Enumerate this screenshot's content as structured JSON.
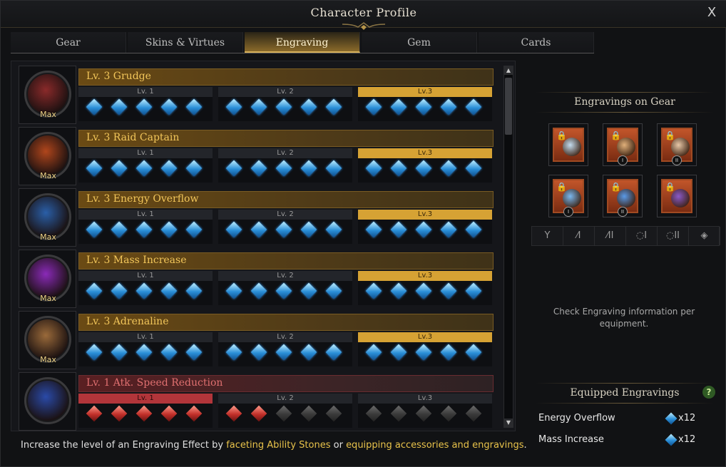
{
  "window": {
    "title": "Character Profile",
    "close_label": "X"
  },
  "tabs": [
    {
      "label": "Gear",
      "active": false
    },
    {
      "label": "Skins & Virtues",
      "active": false
    },
    {
      "label": "Engraving",
      "active": true
    },
    {
      "label": "Gem",
      "active": false
    },
    {
      "label": "Cards",
      "active": false
    }
  ],
  "engravings": [
    {
      "name": "Lv. 3 Grudge",
      "max_label": "Max",
      "levels": [
        "Lv. 1",
        "Lv. 2",
        "Lv.3"
      ],
      "active_level": 3,
      "filled_nodes": 15,
      "type": "positive",
      "color": "#8a2a2a"
    },
    {
      "name": "Lv. 3 Raid Captain",
      "max_label": "Max",
      "levels": [
        "Lv. 1",
        "Lv. 2",
        "Lv.3"
      ],
      "active_level": 3,
      "filled_nodes": 15,
      "type": "positive",
      "color": "#b0461c"
    },
    {
      "name": "Lv. 3 Energy Overflow",
      "max_label": "Max",
      "levels": [
        "Lv. 1",
        "Lv. 2",
        "Lv.3"
      ],
      "active_level": 3,
      "filled_nodes": 15,
      "type": "positive",
      "color": "#2a5fa8"
    },
    {
      "name": "Lv. 3 Mass Increase",
      "max_label": "Max",
      "levels": [
        "Lv. 1",
        "Lv. 2",
        "Lv.3"
      ],
      "active_level": 3,
      "filled_nodes": 15,
      "type": "positive",
      "color": "#8a2ab8"
    },
    {
      "name": "Lv. 3 Adrenaline",
      "max_label": "Max",
      "levels": [
        "Lv. 1",
        "Lv. 2",
        "Lv.3"
      ],
      "active_level": 3,
      "filled_nodes": 15,
      "type": "positive",
      "color": "#9a6a3a"
    },
    {
      "name": "Lv. 1 Atk. Speed Reduction",
      "max_label": "",
      "levels": [
        "Lv. 1",
        "Lv. 2",
        "Lv.3"
      ],
      "active_level": 1,
      "filled_nodes": 7,
      "type": "negative",
      "color": "#2a4aa8"
    }
  ],
  "footer": {
    "hint_prefix": "Increase the level of an Engraving Effect by ",
    "hint_link1": "faceting Ability Stones",
    "hint_mid": " or ",
    "hint_link2": "equipping accessories and engravings",
    "hint_suffix": "."
  },
  "side": {
    "gear_title": "Engravings on Gear",
    "slots": [
      {
        "icon": "necklace-icon",
        "numeral": "",
        "locked": true
      },
      {
        "icon": "earring-icon",
        "numeral": "I",
        "locked": true
      },
      {
        "icon": "earring-icon",
        "numeral": "II",
        "locked": true
      },
      {
        "icon": "ring-icon",
        "numeral": "I",
        "locked": true
      },
      {
        "icon": "ring-icon",
        "numeral": "II",
        "locked": true
      },
      {
        "icon": "ability-stone-icon",
        "numeral": "",
        "locked": true
      }
    ],
    "type_buttons": [
      {
        "icon": "necklace-icon",
        "label": "Ү"
      },
      {
        "icon": "earring-1-icon",
        "label": "⁄I"
      },
      {
        "icon": "earring-2-icon",
        "label": "⁄II"
      },
      {
        "icon": "ring-1-icon",
        "label": "◌I"
      },
      {
        "icon": "ring-2-icon",
        "label": "◌II"
      },
      {
        "icon": "stone-icon",
        "label": "◈"
      }
    ],
    "info_text": "Check Engraving information per equipment.",
    "equipped_title": "Equipped Engravings",
    "help_label": "?",
    "equipped": [
      {
        "name": "Energy Overflow",
        "count": "x12"
      },
      {
        "name": "Mass Increase",
        "count": "x12"
      }
    ]
  },
  "colors": {
    "accent_gold": "#d6a234",
    "negative_red": "#b2353a",
    "gem_blue": "#2a8fd8"
  }
}
